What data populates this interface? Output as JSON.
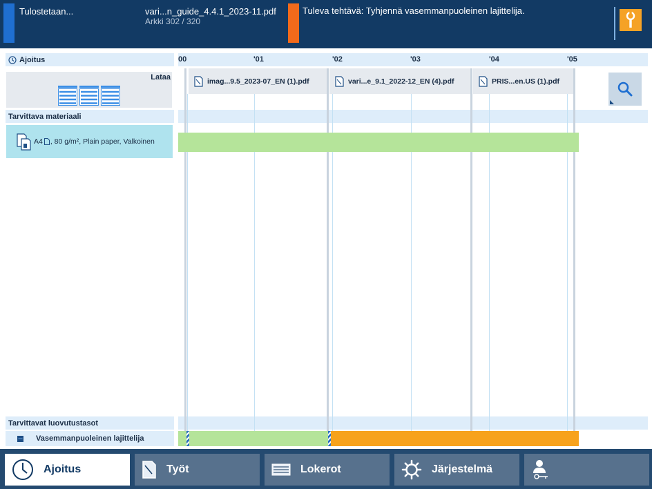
{
  "header": {
    "status": "Tulostetaan...",
    "current_job": "vari...n_guide_4.4.1_2023-11.pdf",
    "sheets_label": "Arkki",
    "sheets_progress": "302 / 320",
    "next_task": "Tuleva tehtävä: Tyhjennä vasemmanpuoleinen lajittelija.",
    "colors": {
      "status_bar": "#1f6fd1",
      "next_task_bar": "#f26a1b",
      "tool_button": "#f5a226"
    }
  },
  "schedule": {
    "title": "Ajoitus",
    "hours": [
      "00",
      "'01",
      "'02",
      "'03",
      "'04",
      "'05"
    ],
    "load_label": "Lataa",
    "jobs": [
      {
        "name": "imag...9.5_2023-07_EN (1).pdf"
      },
      {
        "name": "vari...e_9.1_2022-12_EN (4).pdf"
      },
      {
        "name": "PRIS...en.US (1).pdf"
      }
    ]
  },
  "material": {
    "title": "Tarvittava materiaali",
    "size": "A4",
    "details": ", 80 g/m², Plain paper, Valkoinen",
    "bar_color": "#b5e49a"
  },
  "outputs": {
    "title": "Tarvittavat luovutustasot",
    "location": "Vasemmanpuoleinen lajittelija",
    "bar_colors": {
      "done": "#b5e49a",
      "pending": "#f7a21c"
    }
  },
  "nav": {
    "items": [
      {
        "label": "Ajoitus",
        "icon": "clock-icon",
        "active": true
      },
      {
        "label": "Työt",
        "icon": "document-icon",
        "active": false
      },
      {
        "label": "Lokerot",
        "icon": "tray-icon",
        "active": false
      },
      {
        "label": "Järjestelmä",
        "icon": "gear-icon",
        "active": false
      },
      {
        "label": "",
        "icon": "user-key-icon",
        "active": false
      }
    ]
  }
}
